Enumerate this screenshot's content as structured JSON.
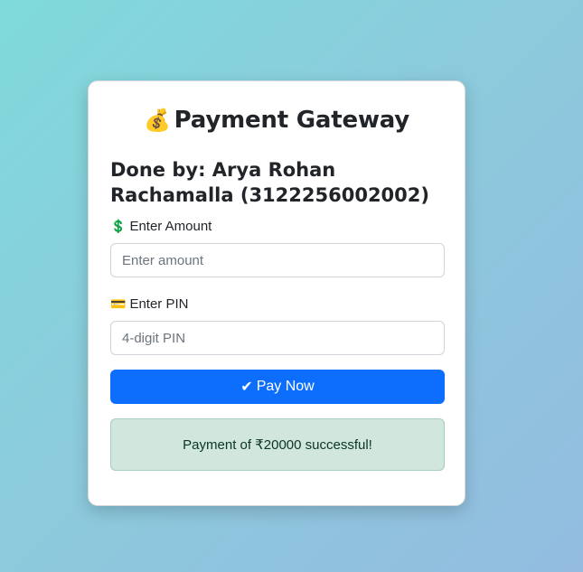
{
  "card": {
    "title_icon": "money-bag-icon",
    "title_emoji": "💰",
    "title": "Payment Gateway",
    "subtitle": "Done by: Arya Rohan Rachamalla (3122256002002)"
  },
  "form": {
    "amount": {
      "icon": "dollar-sign-icon",
      "icon_glyph": "💲",
      "label": "Enter Amount",
      "value": "",
      "placeholder": "Enter amount"
    },
    "pin": {
      "icon": "credit-card-icon",
      "icon_glyph": "💳",
      "label": "Enter PIN",
      "value": "",
      "placeholder": "4-digit PIN"
    },
    "pay_button": {
      "icon": "check-icon",
      "icon_glyph": "✔",
      "label": "Pay Now"
    }
  },
  "status": {
    "message": "Payment of ₹20000 successful!"
  },
  "colors": {
    "primary": "#0d6efd",
    "success_bg": "#d1e7dd",
    "success_border": "#a3cfbb",
    "background_start": "#7fdadb",
    "background_end": "#93bce0"
  }
}
